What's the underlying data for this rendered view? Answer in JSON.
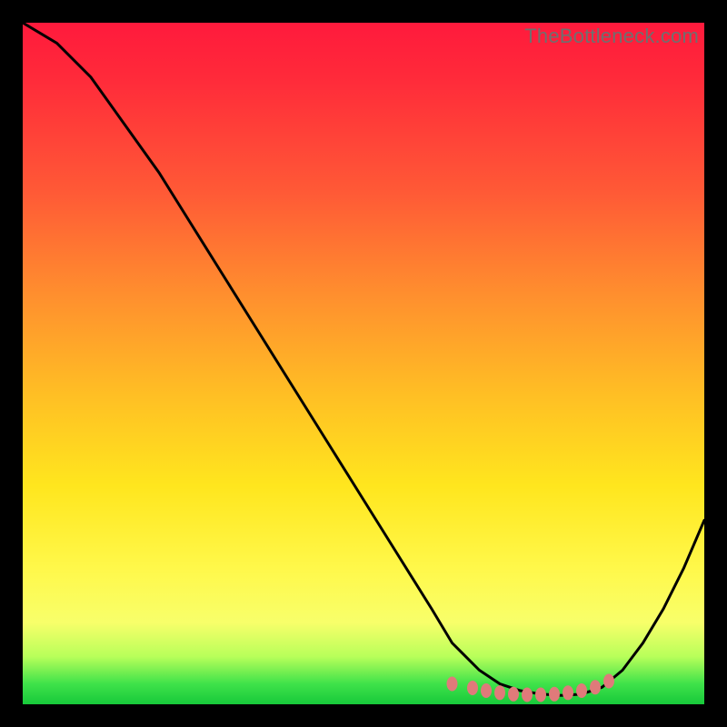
{
  "watermark": "TheBottleneck.com",
  "chart_data": {
    "type": "line",
    "title": "",
    "xlabel": "",
    "ylabel": "",
    "xlim": [
      0,
      100
    ],
    "ylim": [
      0,
      100
    ],
    "background_gradient": {
      "direction": "top-to-bottom",
      "stops": [
        {
          "pos": 0,
          "color": "#ff1a3c"
        },
        {
          "pos": 25,
          "color": "#ff5a36"
        },
        {
          "pos": 55,
          "color": "#ffc024"
        },
        {
          "pos": 80,
          "color": "#fff84a"
        },
        {
          "pos": 97,
          "color": "#3fe24a"
        },
        {
          "pos": 100,
          "color": "#17c93a"
        }
      ]
    },
    "series": [
      {
        "name": "bottleneck-curve",
        "color": "#000000",
        "x": [
          0,
          5,
          10,
          15,
          20,
          25,
          30,
          35,
          40,
          45,
          50,
          55,
          60,
          63,
          67,
          70,
          73,
          76,
          79,
          82,
          85,
          88,
          91,
          94,
          97,
          100
        ],
        "y": [
          100,
          97,
          92,
          85,
          78,
          70,
          62,
          54,
          46,
          38,
          30,
          22,
          14,
          9,
          5,
          3,
          2,
          1.5,
          1.3,
          1.5,
          2.5,
          5,
          9,
          14,
          20,
          27
        ]
      }
    ],
    "markers": {
      "name": "optimal-range-dots",
      "color": "#e07a7a",
      "x": [
        63,
        66,
        68,
        70,
        72,
        74,
        76,
        78,
        80,
        82,
        84,
        86
      ],
      "y": [
        3.0,
        2.4,
        2.0,
        1.7,
        1.5,
        1.4,
        1.4,
        1.5,
        1.7,
        2.0,
        2.5,
        3.4
      ]
    }
  }
}
